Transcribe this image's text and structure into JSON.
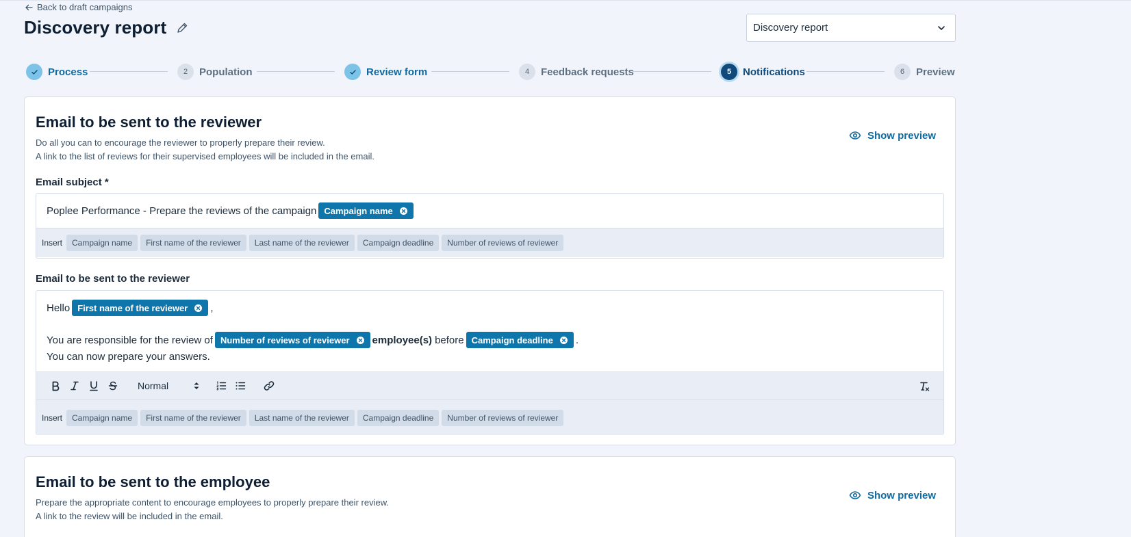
{
  "header": {
    "back_label": "Back to draft campaigns",
    "title": "Discovery report",
    "template_select_value": "Discovery report"
  },
  "steps": [
    {
      "num": "",
      "label": "Process",
      "state": "done"
    },
    {
      "num": "2",
      "label": "Population",
      "state": "todo"
    },
    {
      "num": "",
      "label": "Review form",
      "state": "done"
    },
    {
      "num": "4",
      "label": "Feedback requests",
      "state": "todo"
    },
    {
      "num": "5",
      "label": "Notifications",
      "state": "active"
    },
    {
      "num": "6",
      "label": "Preview",
      "state": "todo"
    }
  ],
  "reviewer_email": {
    "title": "Email to be sent to the reviewer",
    "desc_line1": "Do all you can to encourage the reviewer to properly prepare their review.",
    "desc_line2": "A link to the list of reviews for their supervised employees will be included in the email.",
    "show_preview": "Show preview",
    "subject_label": "Email subject *",
    "subject_text": "Poplee Performance - Prepare the reviews of the campaign",
    "subject_chip": "Campaign name",
    "body_label": "Email to be sent to the reviewer",
    "body_hello": "Hello",
    "body_chip_first_name": "First name of the reviewer",
    "body_comma": ",",
    "body_line2_start": "You are responsible for the review of",
    "body_chip_number": "Number of reviews of reviewer",
    "body_employees": "employee(s)",
    "body_before": "before",
    "body_chip_deadline": "Campaign deadline",
    "body_period": ".",
    "body_line3": "You can now prepare your answers.",
    "format_value": "Normal"
  },
  "insert": {
    "label": "Insert",
    "chips": [
      "Campaign name",
      "First name of the reviewer",
      "Last name of the reviewer",
      "Campaign deadline",
      "Number of reviews of reviewer"
    ]
  },
  "employee_email": {
    "title": "Email to be sent to the employee",
    "desc_line1": "Prepare the appropriate content to encourage employees to properly prepare their review.",
    "desc_line2": "A link to the review will be included in the email.",
    "show_preview": "Show preview"
  },
  "colors": {
    "accent": "#0f76ab",
    "active_step": "#0f4a7a",
    "done_step": "#7dc3e8",
    "background": "#f1f4fa"
  }
}
